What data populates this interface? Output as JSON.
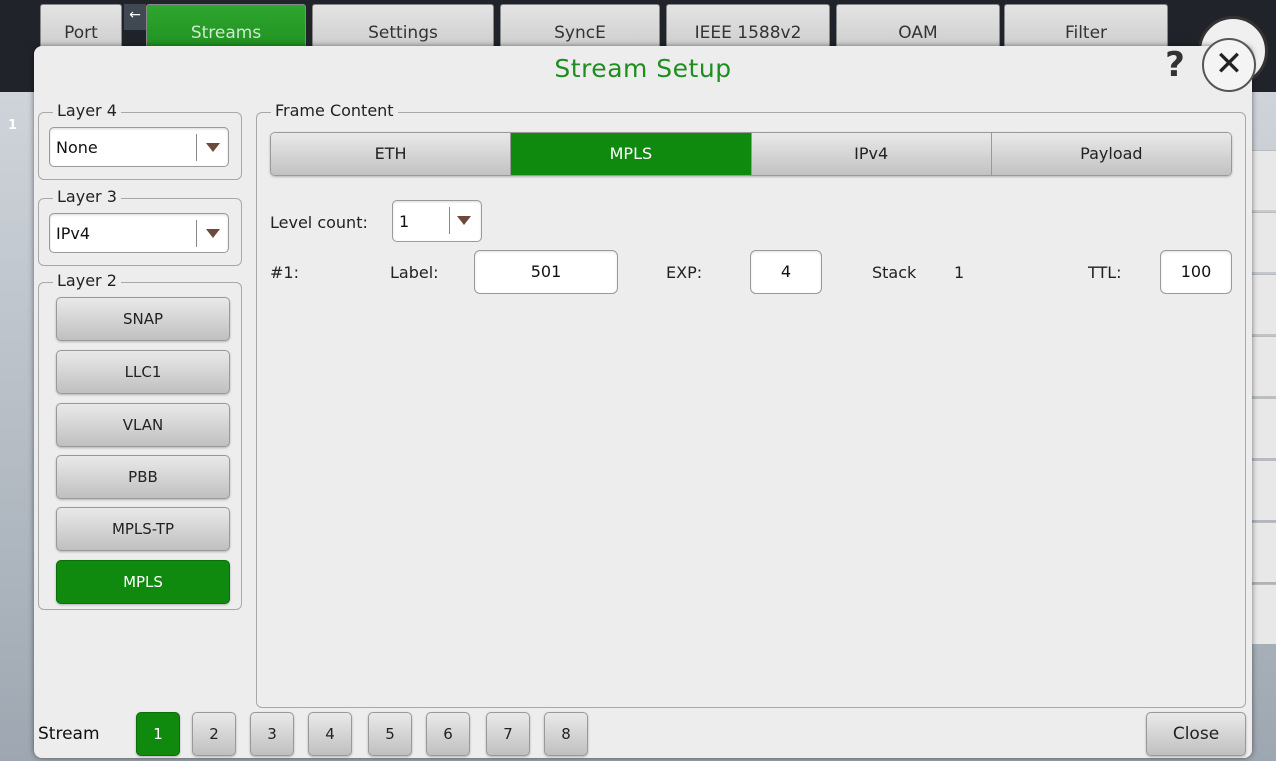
{
  "background": {
    "tabs": [
      "Port",
      "Streams",
      "Settings",
      "SyncE",
      "IEEE 1588v2",
      "OAM",
      "Filter"
    ],
    "active_tab": "Streams",
    "row_number": "1"
  },
  "dialog": {
    "title": "Stream Setup",
    "help_label": "?",
    "close_icon_label": "✕"
  },
  "layer4": {
    "title": "Layer 4",
    "value": "None"
  },
  "layer3": {
    "title": "Layer 3",
    "value": "IPv4"
  },
  "layer2": {
    "title": "Layer 2",
    "buttons": [
      "SNAP",
      "LLC1",
      "VLAN",
      "PBB",
      "MPLS-TP",
      "MPLS"
    ],
    "active": "MPLS"
  },
  "frame_content": {
    "title": "Frame Content",
    "tabs": [
      "ETH",
      "MPLS",
      "IPv4",
      "Payload"
    ],
    "active_tab": "MPLS",
    "level_count": {
      "label": "Level count:",
      "value": "1"
    },
    "level1": {
      "index": "#1:",
      "label_label": "Label:",
      "label_value": "501",
      "exp_label": "EXP:",
      "exp_value": "4",
      "stack_label": "Stack",
      "stack_value": "1",
      "ttl_label": "TTL:",
      "ttl_value": "100"
    }
  },
  "stream_bar": {
    "label": "Stream",
    "streams": [
      "1",
      "2",
      "3",
      "4",
      "5",
      "6",
      "7",
      "8"
    ],
    "active": "1",
    "close_label": "Close"
  },
  "colors": {
    "accent_green": "#0f8a0f",
    "title_green": "#1e8e1e"
  }
}
